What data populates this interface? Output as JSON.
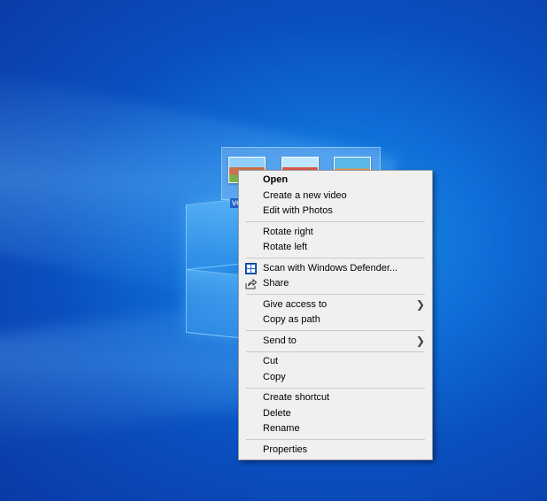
{
  "desktop": {
    "selected_icon_label": "vect"
  },
  "context_menu": {
    "groups": [
      [
        {
          "label": "Open",
          "bold": true
        },
        {
          "label": "Create a new video"
        },
        {
          "label": "Edit with Photos"
        }
      ],
      [
        {
          "label": "Rotate right"
        },
        {
          "label": "Rotate left"
        }
      ],
      [
        {
          "label": "Scan with Windows Defender...",
          "icon": "windows-defender-icon"
        },
        {
          "label": "Share",
          "icon": "share-icon"
        }
      ],
      [
        {
          "label": "Give access to",
          "submenu": true
        },
        {
          "label": "Copy as path"
        }
      ],
      [
        {
          "label": "Send to",
          "submenu": true
        }
      ],
      [
        {
          "label": "Cut"
        },
        {
          "label": "Copy"
        }
      ],
      [
        {
          "label": "Create shortcut"
        },
        {
          "label": "Delete"
        },
        {
          "label": "Rename"
        }
      ],
      [
        {
          "label": "Properties"
        }
      ]
    ]
  },
  "colors": {
    "menu_background": "#f0f0f0",
    "defender_blue": "#1f64c8"
  }
}
